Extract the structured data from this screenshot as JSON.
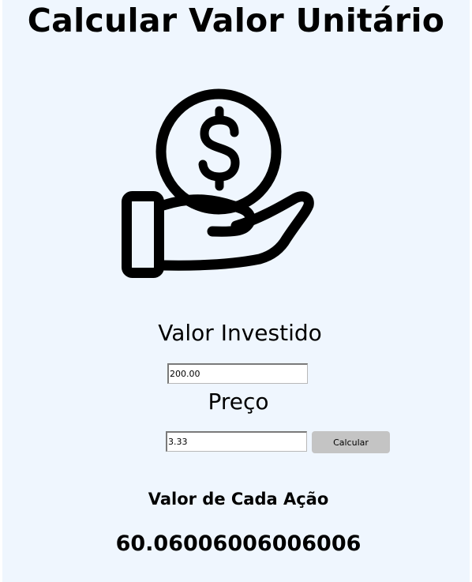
{
  "header": {
    "title": "Calcular Valor Unitário"
  },
  "illustration": {
    "icon": "hand-holding-dollar-icon"
  },
  "form": {
    "investido_label": "Valor Investido",
    "investido_value": "200.00",
    "preco_label": "Preço",
    "preco_value": "3.33",
    "calcular_label": "Calcular"
  },
  "result": {
    "label": "Valor de Cada Ação",
    "value": "60.06006006006006"
  },
  "colors": {
    "background": "#eff6fe",
    "button": "#c4c4c4",
    "text": "#000000"
  }
}
